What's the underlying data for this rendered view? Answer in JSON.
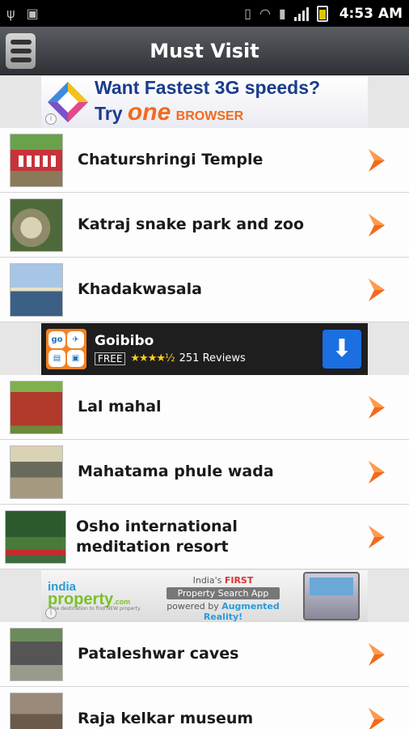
{
  "status_bar": {
    "time": "4:53 AM",
    "icons_left": [
      "usb-icon",
      "android-icon"
    ],
    "icons_right": [
      "vibrate-icon",
      "wifi-icon",
      "sd-card-icon",
      "signal-icon",
      "battery-icon"
    ]
  },
  "header": {
    "title": "Must Visit",
    "menu_icon": "menu-icon"
  },
  "ads": {
    "one_browser": {
      "line1": "Want Fastest 3G speeds?",
      "line2_prefix": "Try",
      "brand": "one",
      "brand_suffix": "BROWSER"
    },
    "goibibo": {
      "name": "Goibibo",
      "price": "FREE",
      "stars": "★★★★½",
      "reviews": "251 Reviews"
    },
    "india_property": {
      "logo_line1": "india",
      "logo_line2": "property",
      "logo_domain": ".com",
      "tagline": "One destination to find NEW property",
      "headline_prefix": "India's",
      "headline_highlight": "FIRST",
      "headline_main": "Property Search App",
      "powered_prefix": "powered by",
      "powered_highlight": "Augmented Reality!"
    }
  },
  "places": [
    {
      "label": "Chaturshringi Temple"
    },
    {
      "label": "Katraj snake park and zoo"
    },
    {
      "label": "Khadakwasala"
    },
    {
      "label": "Lal mahal"
    },
    {
      "label": "Mahatama phule wada"
    },
    {
      "label": "Osho international meditation resort"
    },
    {
      "label": "Pataleshwar caves"
    },
    {
      "label": "Raja kelkar museum"
    }
  ],
  "colors": {
    "accent_orange": "#f26a1b",
    "header_dark": "#2e3236",
    "list_bg": "#fdfdfd"
  }
}
